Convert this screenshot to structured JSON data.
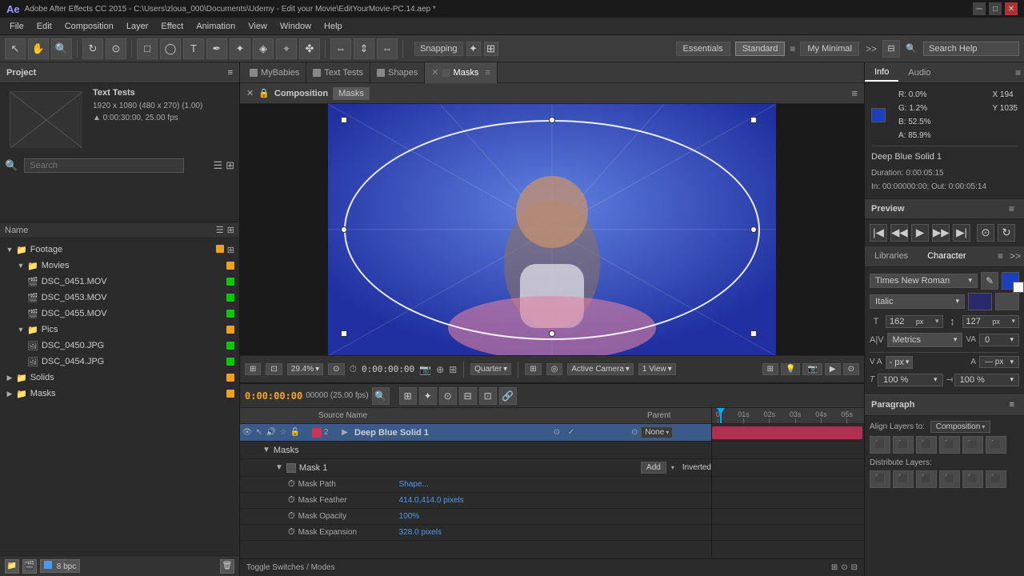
{
  "titlebar": {
    "title": "Adobe After Effects CC 2015 - C:\\Users\\zloua_000\\Documents\\Udemy - Edit your Movie\\EditYourMovie-PC.14.aep *",
    "ae_logo": "Ae"
  },
  "menubar": {
    "items": [
      "File",
      "Edit",
      "Composition",
      "Layer",
      "Effect",
      "Animation",
      "View",
      "Window",
      "Help"
    ]
  },
  "toolbar": {
    "snapping_label": "Snapping",
    "workspace_buttons": [
      "Essentials",
      "Standard",
      "My Minimal"
    ],
    "active_workspace": "Standard",
    "search_placeholder": "Search Help"
  },
  "left_panel": {
    "project_header": "Project",
    "comp_name": "Text Tests",
    "comp_details": "1920 x 1080  (480 x 270) (1.00)",
    "comp_duration": "▲ 0:00:30:00, 25.00 fps",
    "tree": {
      "columns": [
        "Name"
      ],
      "items": [
        {
          "level": 0,
          "label": "Footage",
          "type": "folder",
          "expanded": true,
          "color": "#f0a020"
        },
        {
          "level": 1,
          "label": "Movies",
          "type": "folder",
          "expanded": true,
          "color": "#f0a020"
        },
        {
          "level": 2,
          "label": "DSC_0451.MOV",
          "type": "file",
          "color": "#00cc00"
        },
        {
          "level": 2,
          "label": "DSC_0453.MOV",
          "type": "file",
          "color": "#00cc00"
        },
        {
          "level": 2,
          "label": "DSC_0455.MOV",
          "type": "file",
          "color": "#00cc00"
        },
        {
          "level": 1,
          "label": "Pics",
          "type": "folder",
          "expanded": true,
          "color": "#f0a020"
        },
        {
          "level": 2,
          "label": "DSC_0450.JPG",
          "type": "image",
          "color": "#00cc00"
        },
        {
          "level": 2,
          "label": "DSC_0454.JPG",
          "type": "image",
          "color": "#00cc00"
        }
      ],
      "other_items": [
        {
          "level": 0,
          "label": "Solids",
          "type": "folder",
          "color": "#f0a020"
        },
        {
          "level": 0,
          "label": "Masks",
          "type": "folder",
          "color": "#f0a020"
        }
      ]
    },
    "bpc": "8 bpc"
  },
  "tabs": [
    {
      "label": "MyBabies",
      "color": "#888",
      "active": false
    },
    {
      "label": "Text Tests",
      "color": "#888",
      "active": false
    },
    {
      "label": "Shapes",
      "color": "#888",
      "active": false
    },
    {
      "label": "Masks",
      "color": "#888",
      "active": true
    }
  ],
  "composition": {
    "title": "Composition",
    "name": "Masks",
    "controls_left": [
      "timecode",
      "zoom_btn",
      "fit_btn",
      "render_btn",
      "cam_btn"
    ],
    "timecode": "0:00:00:00",
    "zoom": "29.4%",
    "resolution": "Quarter",
    "view": "Active Camera",
    "views": "1 View"
  },
  "info_panel": {
    "tabs": [
      "Info",
      "Audio"
    ],
    "active_tab": "Info",
    "r": "R: 0.0%",
    "g": "G: 1.2%",
    "b": "B: 52.5%",
    "a": "A: 85.9%",
    "x": "X 194",
    "y": "Y 1035",
    "item_name": "Deep Blue Solid 1",
    "duration": "Duration: 0:00:05:15",
    "in_point": "In: 00:00000:00; Out: 0:00:05:14"
  },
  "character_panel": {
    "tabs": [
      "Libraries",
      "Character"
    ],
    "active_tab": "Character",
    "font_name": "Times New Roman",
    "font_style": "Italic",
    "font_size": "162 px",
    "font_size_num": "162",
    "line_height": "127 px",
    "line_height_num": "127",
    "metrics_label": "Metrics",
    "va_label": "VA",
    "va_value": "0",
    "px_label": "- px",
    "tracking_label": "T",
    "baseline_label": "A↑",
    "scale_h_label": "T 100 %",
    "scale_v_label": "T 100 %",
    "scale_h": "100 %",
    "scale_v": "100 %"
  },
  "paragraph_panel": {
    "header": "Paragraph",
    "align_label": "Align Layers to:",
    "align_target": "Composition",
    "distribute_label": "Distribute Layers:"
  },
  "timeline": {
    "timecode": "0:00:00:00",
    "fps": "00000 (25.00 fps)",
    "layer_name": "Deep Blue Solid 1",
    "layer_num": "2",
    "layer_color": "#cc3355",
    "parent": "None",
    "masks_section": "Masks",
    "mask_name": "Mask 1",
    "mask_mode": "Add",
    "mask_inverted": "Inverted",
    "mask_path_label": "Mask Path",
    "mask_path_value": "Shape...",
    "mask_feather_label": "Mask Feather",
    "mask_feather_value": "414.0,414.0 pixels",
    "mask_opacity_label": "Mask Opacity",
    "mask_opacity_value": "100%",
    "mask_expansion_label": "Mask Expansion",
    "mask_expansion_value": "328.0 pixels",
    "col_headers": [
      "Source Name",
      "Parent"
    ],
    "ruler_marks": [
      "01s",
      "02s",
      "03s",
      "04s",
      "05s"
    ],
    "status_bar": "Toggle Switches / Modes"
  }
}
